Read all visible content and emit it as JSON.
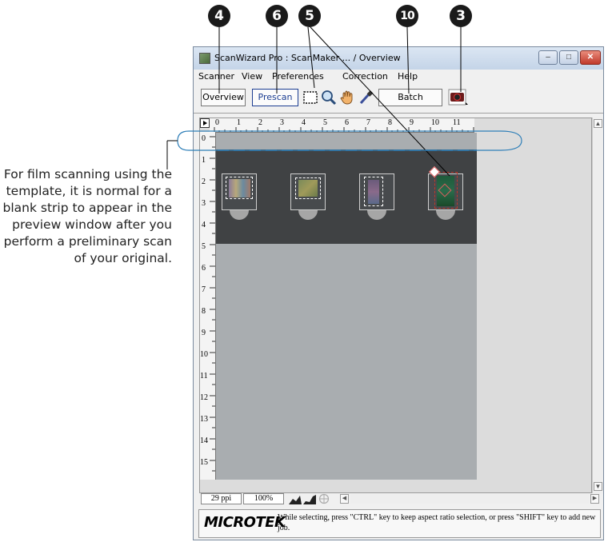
{
  "callouts": [
    "4",
    "6",
    "5",
    "10",
    "3"
  ],
  "annotation": "For film scanning using the template, it is normal for a blank strip to appear in the preview window after you perform a preliminary scan of your original.",
  "window": {
    "title": "ScanWizard Pro : ScanMaker ... / Overview",
    "controls": {
      "minimize": "–",
      "maximize": "□",
      "close": "✕"
    }
  },
  "menu": [
    "Scanner",
    "View",
    "Preferences",
    "Correction",
    "Help"
  ],
  "toolbar": {
    "overview_label": "Overview",
    "prescan_label": "Prescan",
    "batch_label": "Batch",
    "tools": [
      "marquee-tool-icon",
      "zoom-tool-icon",
      "hand-tool-icon",
      "eyedropper-tool-icon",
      "scanner-settings-icon"
    ]
  },
  "rulers": {
    "horizontal": [
      "0",
      "1",
      "2",
      "3",
      "4",
      "5",
      "6",
      "7",
      "8",
      "9",
      "10",
      "11"
    ],
    "vertical": [
      "0",
      "1",
      "2",
      "3",
      "4",
      "5",
      "6",
      "7",
      "8",
      "9",
      "10",
      "11",
      "12",
      "13",
      "14",
      "15"
    ]
  },
  "status": {
    "resolution": "29 ppi",
    "zoom": "100%"
  },
  "footer": {
    "logo": "MICROTEK",
    "hint": "While selecting, press \"CTRL\" key to keep aspect ratio selection, or press \"SHIFT\" key to add new job."
  },
  "colors": {
    "film_strip": "#404244",
    "preview_gray": "#a9adb0",
    "prescan_blue": "#1c3e92",
    "selected_frame_red": "#c0392b"
  }
}
